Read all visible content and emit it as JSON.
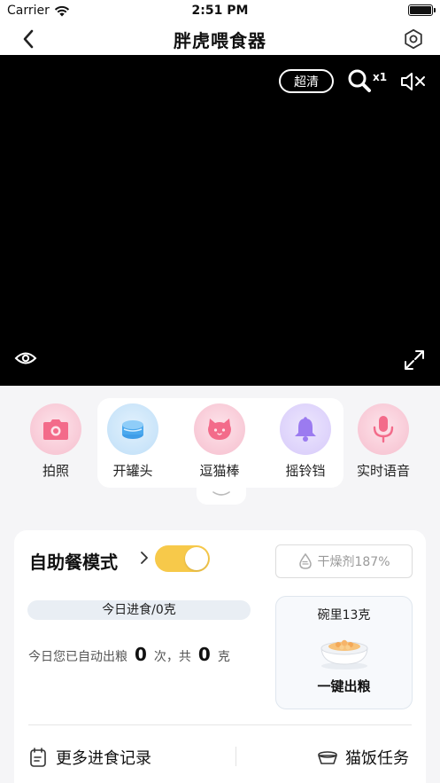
{
  "status_bar": {
    "carrier": "Carrier",
    "time": "2:51 PM"
  },
  "nav": {
    "title": "胖虎喂食器"
  },
  "video": {
    "quality": "超清",
    "zoom": "x1"
  },
  "controls": [
    {
      "label": "拍照",
      "icon": "camera-icon",
      "color": "#f36b8a"
    },
    {
      "label": "开罐头",
      "icon": "can-icon",
      "color": "#4aa8ee"
    },
    {
      "label": "逗猫棒",
      "icon": "cat-icon",
      "color": "#f36b8a"
    },
    {
      "label": "摇铃铛",
      "icon": "bell-icon",
      "color": "#9b7bf0"
    },
    {
      "label": "实时语音",
      "icon": "microphone-icon",
      "color": "#f36b8a"
    }
  ],
  "mode": {
    "title": "自助餐模式",
    "enabled": true,
    "accent": "#f7c94a"
  },
  "desiccant": {
    "label": "干燥剂187%"
  },
  "today": {
    "intake": "今日进食/0克",
    "auto_prefix": "今日您已自动出粮",
    "times": "0",
    "times_unit": "次，共",
    "grams": "0",
    "grams_unit": "克"
  },
  "bowl": {
    "label": "碗里13克",
    "action": "一键出粮"
  },
  "links": {
    "records": "更多进食记录",
    "tasks": "猫饭任务"
  }
}
